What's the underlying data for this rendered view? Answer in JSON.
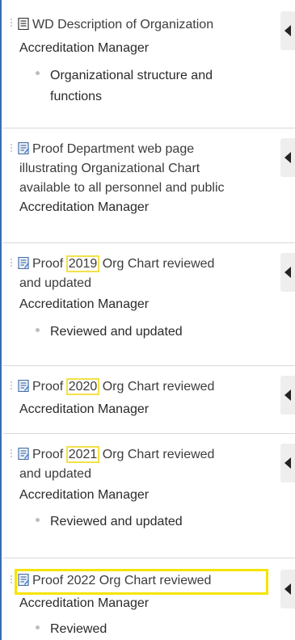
{
  "items": [
    {
      "title_parts": [
        "WD Description of Organization"
      ],
      "icon": "document-icon",
      "owner": "Accreditation Manager",
      "sub_lines": [
        "Organizational structure and",
        "functions"
      ]
    },
    {
      "title_lines": [
        "Proof Department web page",
        "illustrating Organizational Chart",
        "available to all personnel and public"
      ],
      "icon": "proof-document-icon",
      "owner": "Accreditation Manager"
    },
    {
      "title_pre": "Proof ",
      "title_year": "2019",
      "title_post": " Org Chart reviewed",
      "title_line2": "and updated",
      "icon": "proof-document-icon",
      "owner": "Accreditation Manager",
      "sub": "Reviewed and updated"
    },
    {
      "title_pre": "Proof ",
      "title_year": "2020",
      "title_post": " Org Chart reviewed",
      "icon": "proof-document-icon",
      "owner": "Accreditation Manager"
    },
    {
      "title_pre": "Proof ",
      "title_year": "2021",
      "title_post": " Org Chart reviewed",
      "title_line2": "and updated",
      "icon": "proof-document-icon",
      "owner": "Accreditation Manager",
      "sub": "Reviewed and updated"
    },
    {
      "title": "Proof 2022 Org Chart reviewed",
      "icon": "proof-document-icon",
      "owner": "Accreditation Manager",
      "sub": "Reviewed"
    }
  ],
  "colors": {
    "frame": "#3b6db3",
    "highlight": "#f5e400",
    "toggle_bg": "#eeeeee",
    "text": "#333333"
  }
}
